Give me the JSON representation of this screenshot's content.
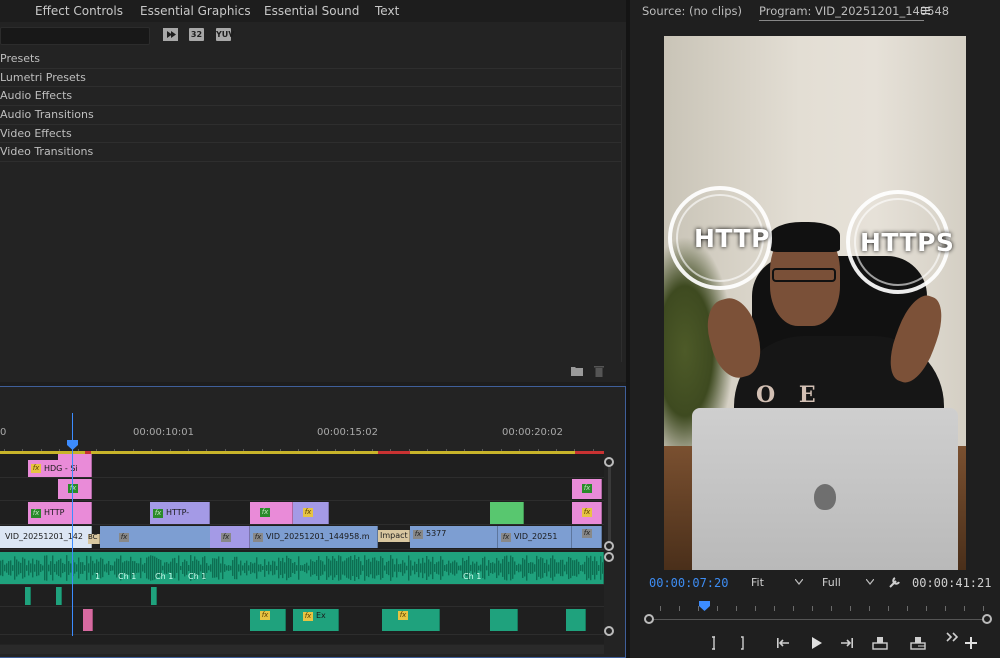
{
  "left_tabs": [
    "Effect Controls",
    "Essential Graphics",
    "Essential Sound",
    "Text"
  ],
  "effects_panel": {
    "format_buttons": [
      "32",
      "YUV"
    ],
    "folders": [
      "Presets",
      "Lumetri Presets",
      "Audio Effects",
      "Audio Transitions",
      "Video Effects",
      "Video Transitions"
    ]
  },
  "timeline": {
    "ruler_labels": [
      "0",
      "00:00:10:01",
      "00:00:15:02",
      "00:00:20:02"
    ],
    "clips": {
      "v4_title": "HDG - Si",
      "v2_http": "HTTP",
      "v2_http2": "HTTP-",
      "v1_vid1": "VID_20251201_142",
      "v1_bo": "BC",
      "v1_vid2": "VID_20251201_144958.m",
      "v1_impact": "Impact",
      "v1_num": "5377",
      "v1_vid3": "VID_20251",
      "a1_label1": "Ch 1",
      "a1_label2": "Ch 1",
      "a1_label3": "Ch 1",
      "a1_label4": "Ch 1",
      "a1_label0": "1",
      "a3_ex": "Ex"
    }
  },
  "monitor": {
    "source_tab": "Source: (no clips)",
    "program_tab": "Program: VID_20251201_140548",
    "overlay_left": "HTTP",
    "overlay_right": "HTTPS",
    "hoodie_text": "O E N",
    "current_timecode": "00:00:07:20",
    "fit_select": "Fit",
    "resolution_select": "Full",
    "duration_timecode": "00:00:41:21"
  },
  "colors": {
    "accent_blue": "#3d8cf2",
    "work_area_yellow": "#c8b42a",
    "clip_pink": "#e98bd8",
    "clip_purple": "#a49ae6",
    "clip_blue": "#7d9ed2",
    "clip_green": "#58c76f",
    "audio_green": "#1fa27d"
  },
  "icons": [
    "search-icon",
    "new-bin-icon",
    "trash-icon",
    "wrench-icon",
    "mark-in-icon",
    "mark-out-icon",
    "go-to-in-icon",
    "play-icon",
    "go-to-out-icon",
    "lift-icon",
    "extract-icon",
    "more-icon",
    "add-icon",
    "panel-menu-icon"
  ]
}
